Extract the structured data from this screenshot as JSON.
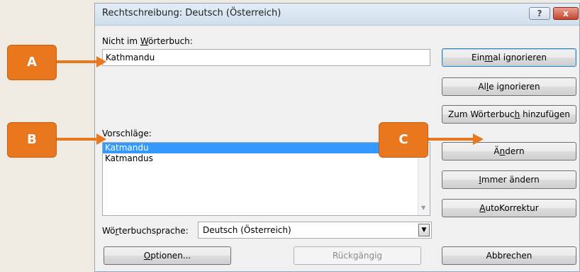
{
  "dialog": {
    "title": "Rechtschreibung: Deutsch (Österreich)",
    "help_label": "?",
    "close_label": "x",
    "not_in_dict_label_pre": "Nicht im ",
    "not_in_dict_label_u": "W",
    "not_in_dict_label_post": "örterbuch:",
    "not_in_dict_value": "Kathmandu",
    "suggestions_label": "Vorschläge:",
    "suggestions": [
      "Katmandu",
      "Katmandus"
    ],
    "selected_suggestion": "Katmandu",
    "dict_lang_label_pre": "Wö",
    "dict_lang_label_u": "r",
    "dict_lang_label_post": "terbuchsprache:",
    "dict_lang_value": "Deutsch (Österreich)",
    "buttons": {
      "ignore_once_pre": "Ein",
      "ignore_once_u": "m",
      "ignore_once_post": "al ignorieren",
      "ignore_all_pre": "Al",
      "ignore_all_u": "l",
      "ignore_all_post": "e ignorieren",
      "add_to_dict_pre": "Zum Wörterbuc",
      "add_to_dict_u": "h",
      "add_to_dict_post": " hinzufügen",
      "change_pre": "Ä",
      "change_u": "n",
      "change_post": "dern",
      "change_all_u": "I",
      "change_all_post": "mmer ändern",
      "autocorrect_u": "A",
      "autocorrect_post": "utoKorrektur",
      "options_u": "O",
      "options_post": "ptionen...",
      "undo": "Rückgängig",
      "cancel": "Abbrechen"
    }
  },
  "callouts": {
    "a": "A",
    "b": "B",
    "c": "C"
  },
  "colors": {
    "callout": "#e8771e",
    "selection": "#3399ff"
  }
}
